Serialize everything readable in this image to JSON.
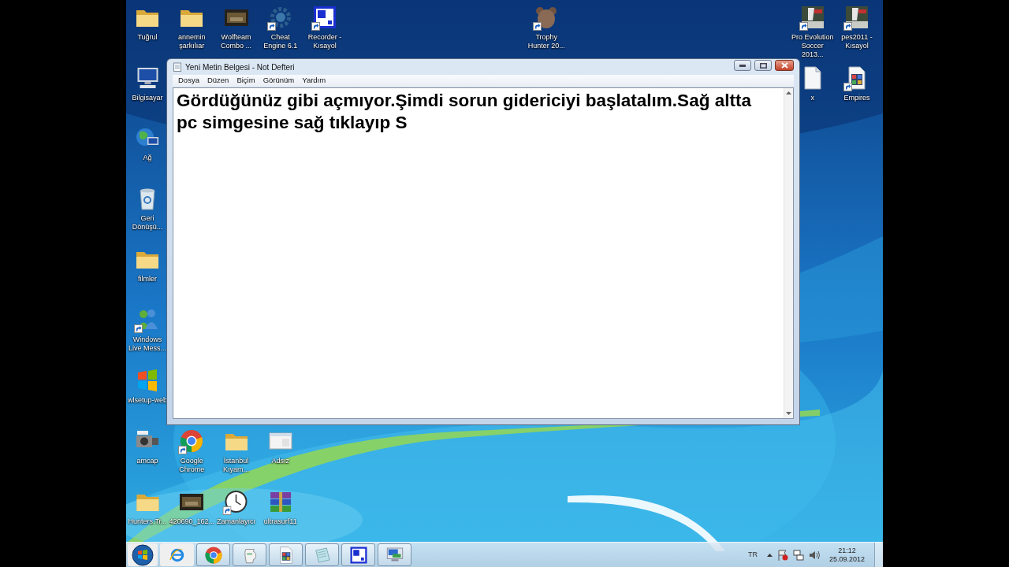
{
  "desktop_icons": [
    {
      "label": "Tuğrul",
      "kind": "folder",
      "shortcut": false
    },
    {
      "label": "annemin şarkılıar",
      "kind": "folder",
      "shortcut": false
    },
    {
      "label": "Wolfteam Combo ...",
      "kind": "video",
      "shortcut": false
    },
    {
      "label": "Cheat Engine 6.1",
      "kind": "gear",
      "shortcut": true
    },
    {
      "label": "Recorder - Kısayol",
      "kind": "recorder",
      "shortcut": true
    },
    {
      "label": "Trophy Hunter 20...",
      "kind": "animal",
      "shortcut": true
    },
    {
      "label": "Pro Evolution Soccer 2013...",
      "kind": "game",
      "shortcut": true
    },
    {
      "label": "pes2011 - Kısayol",
      "kind": "game",
      "shortcut": true
    },
    {
      "label": "Bilgisayar",
      "kind": "computer",
      "shortcut": false
    },
    {
      "label": "x",
      "kind": "document",
      "shortcut": false
    },
    {
      "label": "Empires",
      "kind": "spreadsheet",
      "shortcut": true
    },
    {
      "label": "Ağ",
      "kind": "network",
      "shortcut": false
    },
    {
      "label": "Geri Dönüşü...",
      "kind": "recycle",
      "shortcut": false
    },
    {
      "label": "filmler",
      "kind": "folder",
      "shortcut": false
    },
    {
      "label": "Windows Live Mess...",
      "kind": "messenger",
      "shortcut": true
    },
    {
      "label": "wlsetup-web",
      "kind": "windows",
      "shortcut": false
    },
    {
      "label": "amcap",
      "kind": "camera",
      "shortcut": false
    },
    {
      "label": "Google Chrome",
      "kind": "chrome",
      "shortcut": true
    },
    {
      "label": "İstanbul Kıyam...",
      "kind": "folder",
      "shortcut": false
    },
    {
      "label": "Adsız",
      "kind": "window",
      "shortcut": false
    },
    {
      "label": "Hunters.Tr...",
      "kind": "folder",
      "shortcut": false
    },
    {
      "label": "420690_162...",
      "kind": "video",
      "shortcut": false
    },
    {
      "label": "Zamanlayıcı",
      "kind": "clock",
      "shortcut": true
    },
    {
      "label": "ultrasurf11",
      "kind": "archive",
      "shortcut": false
    }
  ],
  "window": {
    "title": "Yeni Metin Belgesi - Not Defteri",
    "menu": [
      "Dosya",
      "Düzen",
      "Biçim",
      "Görünüm",
      "Yardım"
    ],
    "text": "Gördüğünüz gibi açmıyor.Şimdi sorun gidericiyi başlatalım.Sağ altta pc simgesine sağ tıklayıp S"
  },
  "taskbar": {
    "apps": [
      {
        "kind": "ie",
        "running": false
      },
      {
        "kind": "chrome",
        "running": true
      },
      {
        "kind": "jug",
        "running": true
      },
      {
        "kind": "spreadsheet",
        "running": true
      },
      {
        "kind": "notepad",
        "running": true
      },
      {
        "kind": "recorder",
        "running": true
      },
      {
        "kind": "monitor",
        "running": true
      }
    ],
    "language": "TR",
    "time": "21:12",
    "date": "25.09.2012"
  }
}
